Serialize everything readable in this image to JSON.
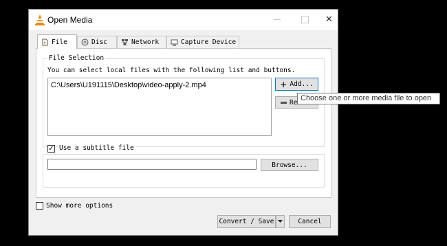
{
  "window": {
    "title": "Open Media",
    "controls": {
      "minimize": "minimize",
      "maximize": "maximize",
      "close": "✕"
    }
  },
  "tabs": [
    {
      "label": "File",
      "icon": "file-icon",
      "active": true
    },
    {
      "label": "Disc",
      "icon": "disc-icon",
      "active": false
    },
    {
      "label": "Network",
      "icon": "network-icon",
      "active": false
    },
    {
      "label": "Capture Device",
      "icon": "capture-device-icon",
      "active": false
    }
  ],
  "file_selection": {
    "legend": "File Selection",
    "description": "You can select local files with the following list and buttons.",
    "files": [
      "C:\\Users\\U191115\\Desktop\\video-apply-2.mp4"
    ],
    "add_label": "Add...",
    "remove_label": "Re"
  },
  "subtitle": {
    "checkbox_label": "Use a subtitle file",
    "checked": true,
    "path_value": "",
    "browse_label": "Browse..."
  },
  "footer": {
    "show_more_label": "Show more options",
    "show_more_checked": false,
    "convert_label": "Convert / Save",
    "cancel_label": "Cancel"
  },
  "tooltip": "Choose one or more media file to open",
  "colors": {
    "accent": "#0078d7",
    "vlc_orange": "#f48a00"
  }
}
